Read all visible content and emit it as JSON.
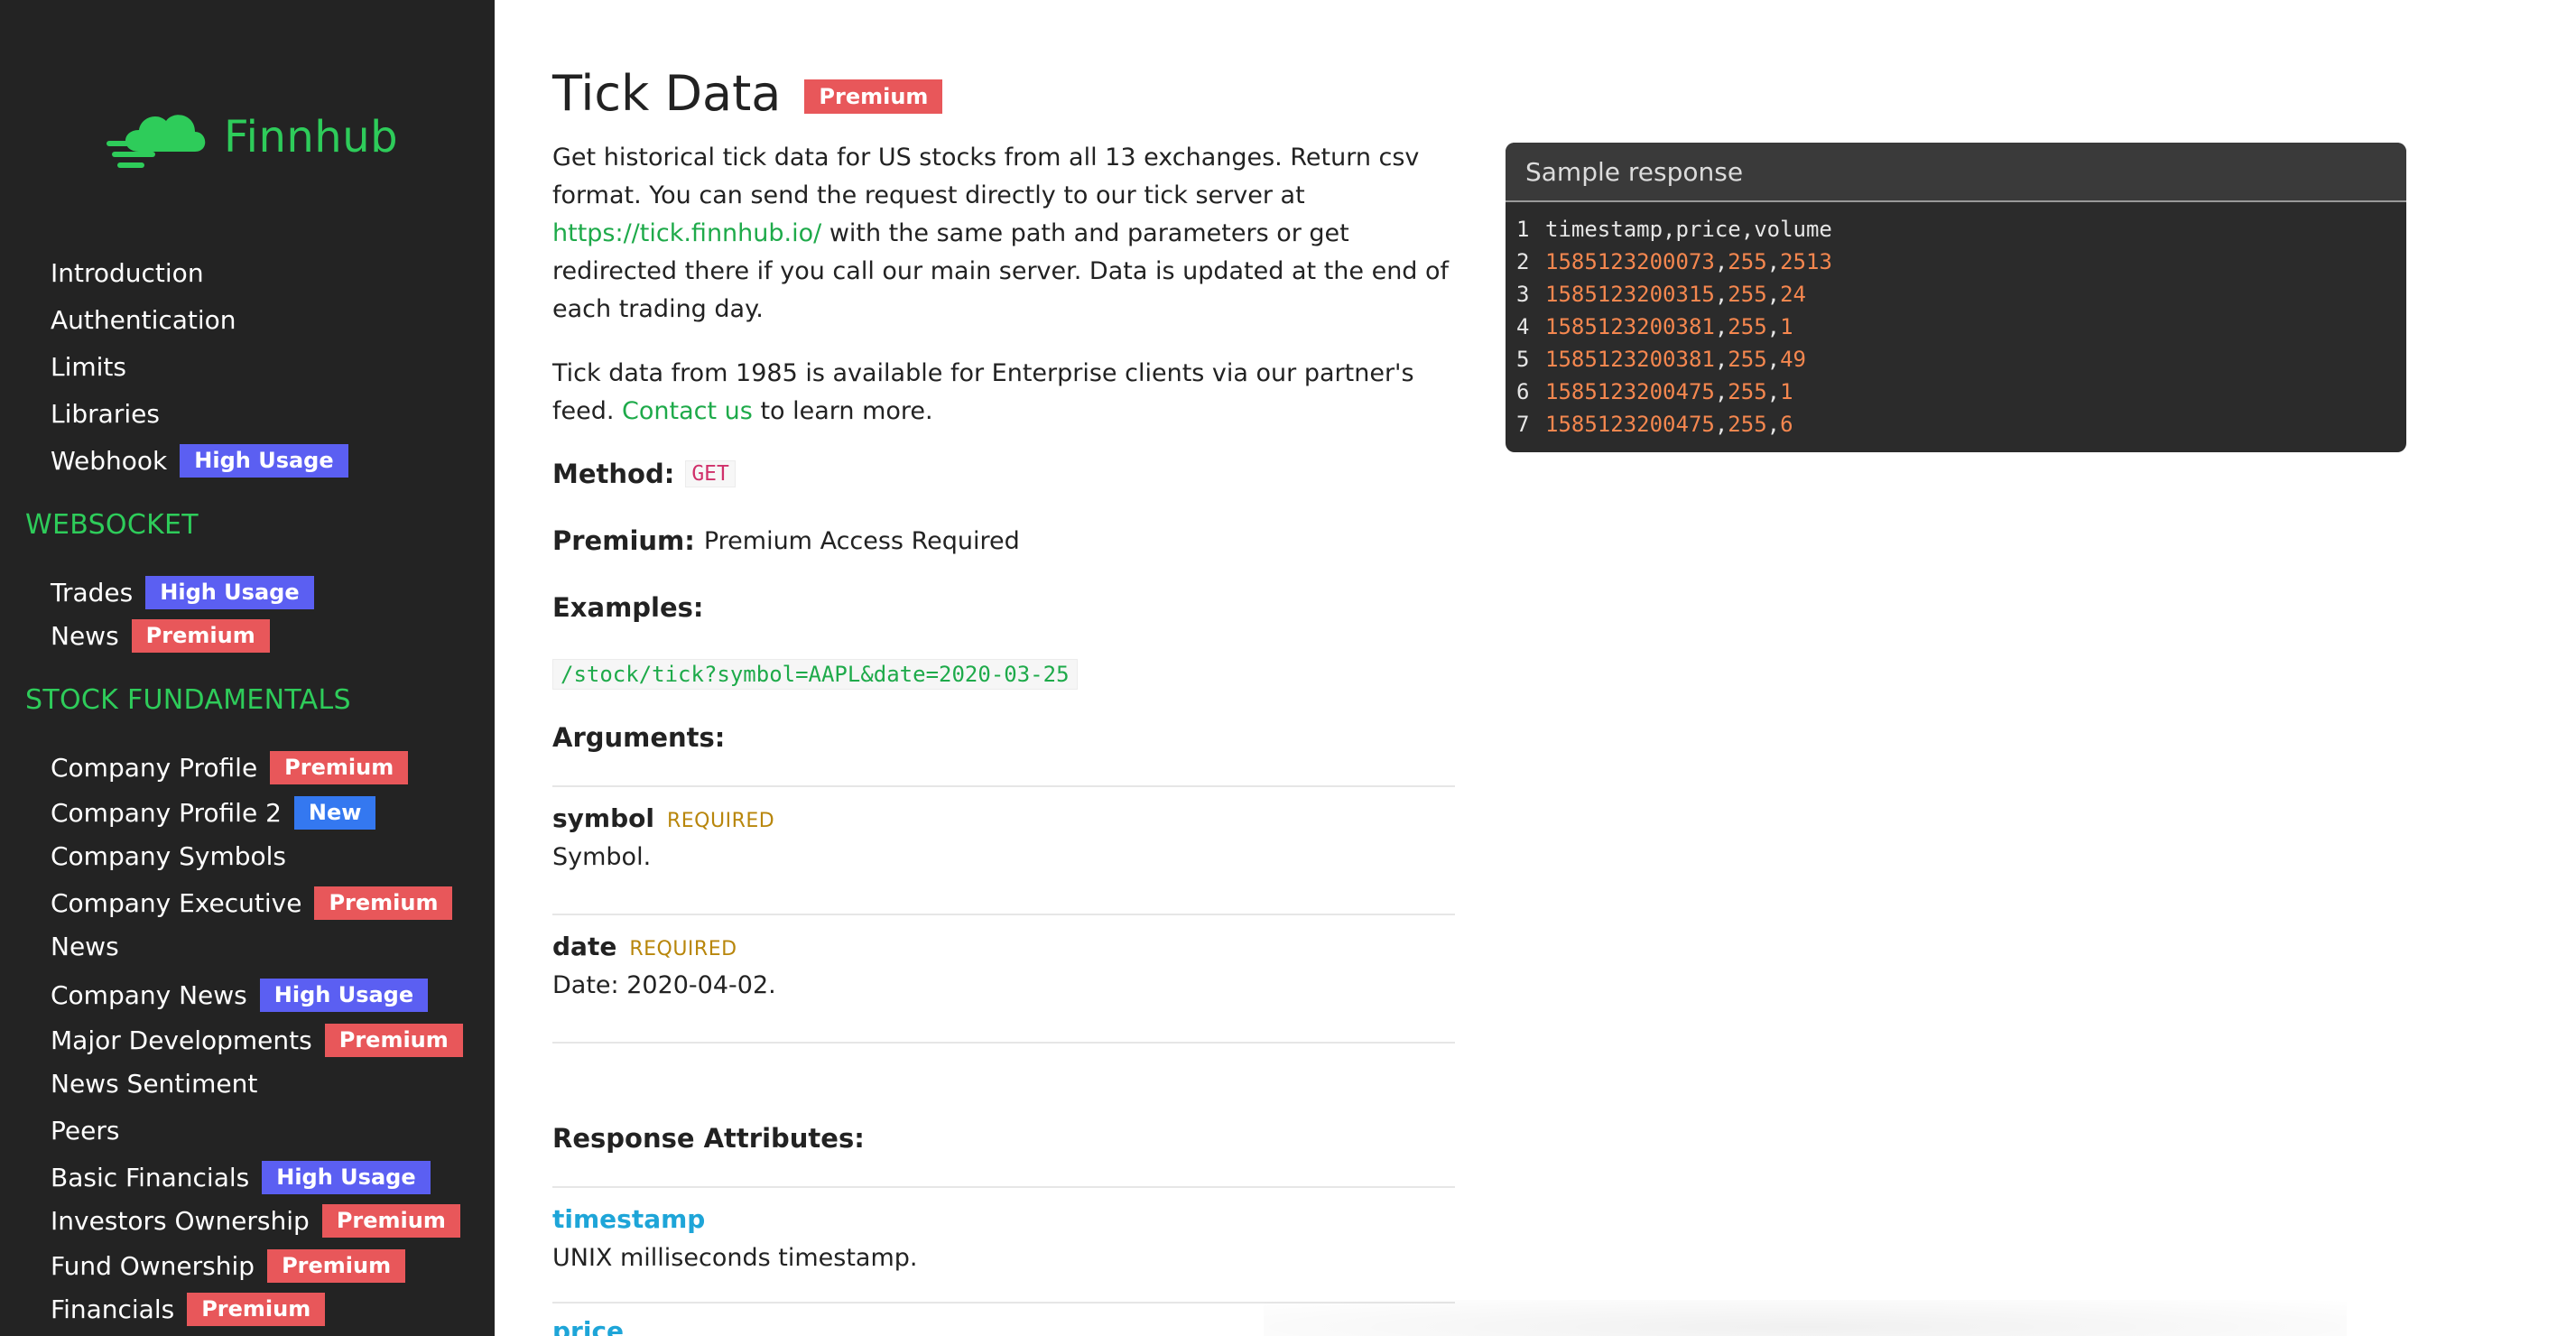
{
  "sidebar": {
    "logo_text": "Finnhub",
    "items": [
      {
        "label": "Introduction"
      },
      {
        "label": "Authentication"
      },
      {
        "label": "Limits"
      },
      {
        "label": "Libraries"
      },
      {
        "label": "Webhook",
        "badge": "High Usage"
      }
    ],
    "sections": [
      {
        "title": "WEBSOCKET",
        "items": [
          {
            "label": "Trades",
            "badge": "High Usage"
          },
          {
            "label": "News",
            "badge": "Premium"
          }
        ]
      },
      {
        "title": "STOCK FUNDAMENTALS",
        "items": [
          {
            "label": "Company Profile",
            "badge": "Premium"
          },
          {
            "label": "Company Profile 2",
            "badge": "New"
          },
          {
            "label": "Company Symbols"
          },
          {
            "label": "Company Executive",
            "badge": "Premium"
          },
          {
            "label": "News"
          },
          {
            "label": "Company News",
            "badge": "High Usage"
          },
          {
            "label": "Major Developments",
            "badge": "Premium"
          },
          {
            "label": "News Sentiment"
          },
          {
            "label": "Peers"
          },
          {
            "label": "Basic Financials",
            "badge": "High Usage"
          },
          {
            "label": "Investors Ownership",
            "badge": "Premium"
          },
          {
            "label": "Fund Ownership",
            "badge": "Premium"
          },
          {
            "label": "Financials",
            "badge": "Premium"
          }
        ]
      }
    ]
  },
  "main": {
    "title": "Tick Data",
    "title_badge": "Premium",
    "desc1_a": "Get historical tick data for US stocks from all 13 exchanges. Return csv format. You can send the request directly to our tick server at ",
    "desc1_link": "https://tick.finnhub.io/",
    "desc1_b": " with the same path and parameters or get redirected there if you call our main server. Data is updated at the end of each trading day.",
    "desc2_a": "Tick data from 1985 is available for Enterprise clients via our partner's feed. ",
    "desc2_link": "Contact us",
    "desc2_b": " to learn more.",
    "method_label": "Method:",
    "method_value": "GET",
    "premium_label": "Premium:",
    "premium_value": "Premium Access Required",
    "examples_label": "Examples:",
    "example_url": "/stock/tick?symbol=AAPL&date=2020-03-25",
    "arguments_label": "Arguments:",
    "arguments": [
      {
        "name": "symbol",
        "required": "REQUIRED",
        "desc": "Symbol."
      },
      {
        "name": "date",
        "required": "REQUIRED",
        "desc": "Date: 2020-04-02."
      }
    ],
    "response_label": "Response Attributes:",
    "attributes": [
      {
        "name": "timestamp",
        "desc": "UNIX milliseconds timestamp."
      },
      {
        "name": "price",
        "desc": ""
      }
    ]
  },
  "sample": {
    "title": "Sample response",
    "header_line": "timestamp,price,volume",
    "rows": [
      [
        "1585123200073",
        "255",
        "2513"
      ],
      [
        "1585123200315",
        "255",
        "24"
      ],
      [
        "1585123200381",
        "255",
        "1"
      ],
      [
        "1585123200381",
        "255",
        "49"
      ],
      [
        "1585123200475",
        "255",
        "1"
      ],
      [
        "1585123200475",
        "255",
        "6"
      ]
    ],
    "line_numbers": [
      "1",
      "2",
      "3",
      "4",
      "5",
      "6",
      "7"
    ]
  },
  "colors": {
    "sidebar_bg": "#232323",
    "accent_green": "#2ecc5a",
    "premium": "#e8575a",
    "high_usage": "#5b5ff2",
    "new": "#3478f0",
    "attr_blue": "#1ea5d8",
    "code_number": "#f5874f"
  }
}
